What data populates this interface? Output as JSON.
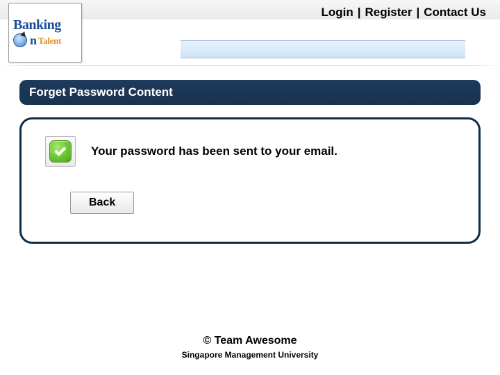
{
  "topnav": {
    "login": "Login",
    "register": "Register",
    "contact": "Contact Us"
  },
  "logo": {
    "line1": "Banking",
    "line2_big": "n",
    "line2_small": "Talent"
  },
  "page": {
    "header": "Forget Password Content",
    "success_message": "Your password has been sent to your email.",
    "back_label": "Back"
  },
  "footer": {
    "copyright": "© Team Awesome",
    "org": "Singapore Management University"
  }
}
